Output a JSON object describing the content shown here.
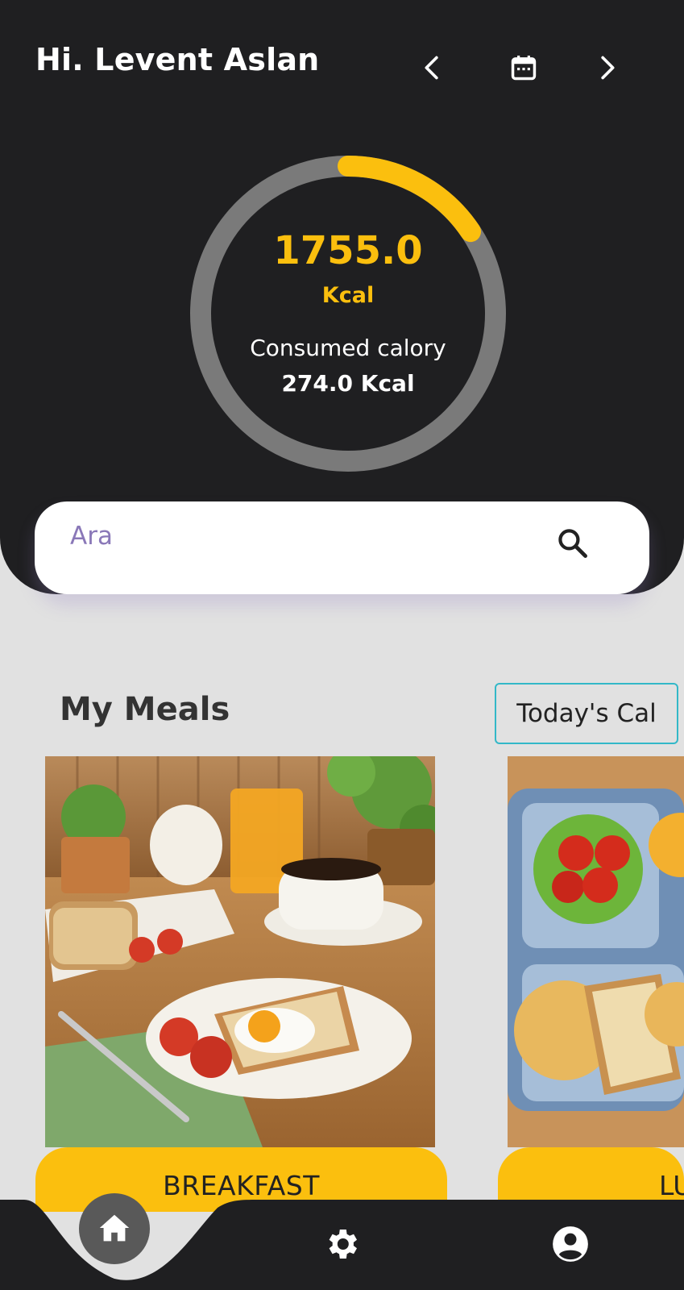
{
  "header": {
    "greeting": "Hi. Levent Aslan",
    "icons": {
      "prev": "chevron-left-icon",
      "calendar": "calendar-icon",
      "next": "chevron-right-icon"
    }
  },
  "calorie_ring": {
    "goal_value": "1755.0",
    "goal_unit": "Kcal",
    "consumed_label": "Consumed calory",
    "consumed_value": "274.0 Kcal",
    "progress_fraction": 0.156,
    "track_color": "#7a7a7a",
    "progress_color": "#fbbf0e"
  },
  "search": {
    "placeholder": "Ara",
    "value": "",
    "icon": "search-icon"
  },
  "meals": {
    "title": "My Meals",
    "todays_button": "Today's Cal",
    "items": [
      {
        "label": "BREAKFAST"
      },
      {
        "label": "LU"
      }
    ]
  },
  "bottom_nav": {
    "items": [
      "home-icon",
      "gear-icon",
      "account-icon"
    ],
    "active": "home-icon"
  },
  "colors": {
    "header_bg": "#1f1f21",
    "accent": "#fbbf0e",
    "page_bg": "#e1e1e1",
    "outline": "#33b8c8"
  }
}
